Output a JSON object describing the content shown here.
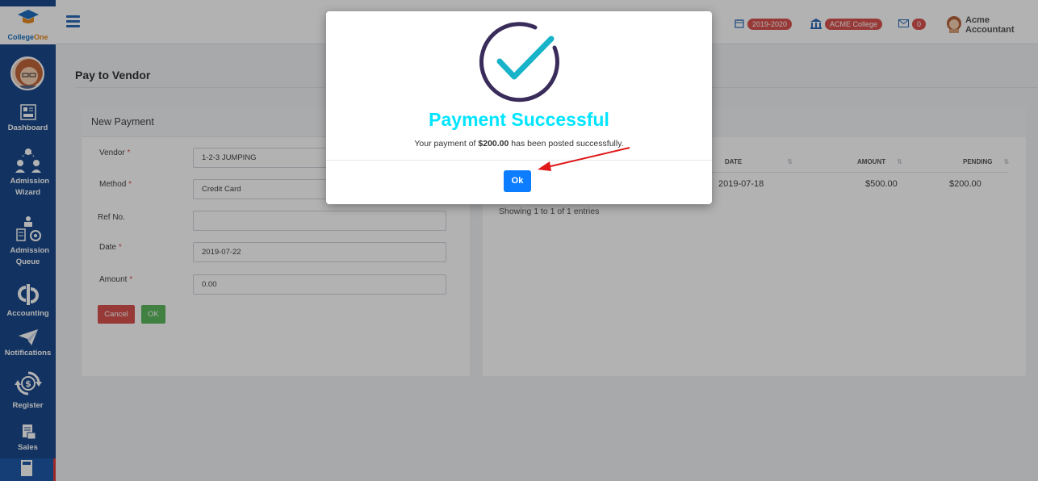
{
  "app": {
    "logo_text_a": "College",
    "logo_text_b": "One"
  },
  "header": {
    "year_badge": "2019-2020",
    "college_badge": "ACME College",
    "mail_count": "0",
    "user_name": "Acme Accountant"
  },
  "sidebar": {
    "items": [
      {
        "label": "Dashboard"
      },
      {
        "label": "Admission Wizard"
      },
      {
        "label": "Admission Queue"
      },
      {
        "label": "Accounting"
      },
      {
        "label": "Notifications"
      },
      {
        "label": "Register"
      },
      {
        "label": "Sales"
      }
    ]
  },
  "page": {
    "title": "Pay to Vendor"
  },
  "form": {
    "title": "New Payment",
    "vendor_label": "Vendor",
    "vendor_value": "1-2-3 JUMPING",
    "method_label": "Method",
    "method_value": "Credit Card",
    "ref_label": "Ref No.",
    "ref_value": "",
    "date_label": "Date",
    "date_value": "2019-07-22",
    "amount_label": "Amount",
    "amount_value": "0.00",
    "required_mark": "*",
    "cancel_label": "Cancel",
    "ok_label": "OK"
  },
  "table": {
    "columns": [
      "DATE",
      "AMOUNT",
      "PENDING"
    ],
    "rows": [
      {
        "date": "2019-07-18",
        "amount": "$500.00",
        "pending": "$200.00"
      }
    ],
    "sort_glyph": "⇅",
    "showing": "Showing 1 to 1 of 1 entries"
  },
  "modal": {
    "title": "Payment Successful",
    "msg_prefix": "Your payment of ",
    "msg_amount": "$200.00",
    "msg_suffix": " has been posted successfully.",
    "ok_label": "Ok"
  },
  "colors": {
    "sidebar": "#1b4a8c",
    "modal_title": "#00e5ff",
    "ok_button": "#0d7dff",
    "check": "#18b3c9",
    "ring": "#3a2c5a"
  }
}
